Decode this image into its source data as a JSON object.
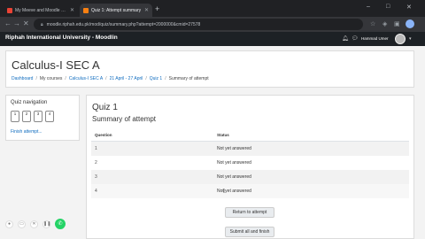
{
  "browser": {
    "tabs": [
      {
        "label": "My Meeve and Moodle session"
      },
      {
        "label": "Quiz 1: Attempt summary"
      }
    ],
    "new_tab_icon": "+",
    "url": "moodle.riphah.edu.pk/mod/quiz/summary.php?attempt=2000000&cmid=27578",
    "window_controls": [
      "–",
      "□",
      "✕"
    ]
  },
  "site": {
    "brand": "Riphah International University - Moodlin",
    "user_name": "Hammad Umer"
  },
  "header": {
    "course_title": "Calculus-I SEC A",
    "breadcrumbs": [
      "Dashboard",
      "My courses",
      "Calculus-I SEC A",
      "21 April - 27 April",
      "Quiz 1",
      "Summary of attempt"
    ]
  },
  "quiz_nav": {
    "title": "Quiz navigation",
    "buttons": [
      "1",
      "2",
      "3",
      "4"
    ],
    "finish_link": "Finish attempt..."
  },
  "main": {
    "quiz_title": "Quiz 1",
    "summary_title": "Summary of attempt",
    "table": {
      "headers": [
        "Question",
        "Status"
      ],
      "rows": [
        {
          "q": "1",
          "status": "Not yet answered"
        },
        {
          "q": "2",
          "status": "Not yet answered"
        },
        {
          "q": "3",
          "status": "Not yet answered"
        },
        {
          "q": "4",
          "status": "Not yet answered"
        }
      ]
    },
    "return_button": "Return to attempt",
    "submit_button": "Submit all and finish"
  },
  "colors": {
    "link": "#0f6cbf",
    "navbar": "#1d2125",
    "browser_dark": "#202124",
    "fab_green": "#25d366"
  }
}
